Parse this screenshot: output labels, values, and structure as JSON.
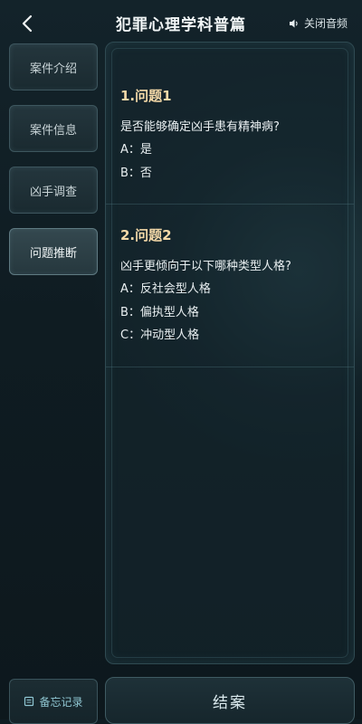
{
  "header": {
    "title": "犯罪心理学科普篇",
    "audio_label": "关闭音频",
    "back_icon": "chevron-left-icon",
    "audio_icon": "speaker-icon"
  },
  "sidebar": {
    "items": [
      {
        "label": "案件介绍",
        "active": false
      },
      {
        "label": "案件信息",
        "active": false
      },
      {
        "label": "凶手调查",
        "active": false
      },
      {
        "label": "问题推断",
        "active": true
      }
    ],
    "memo_label": "备忘记录",
    "memo_icon": "notebook-icon"
  },
  "questions": [
    {
      "title": "1.问题1",
      "text": "是否能够确定凶手患有精神病?",
      "options": [
        "A：是",
        "B：否"
      ]
    },
    {
      "title": "2.问题2",
      "text": "凶手更倾向于以下哪种类型人格?",
      "options": [
        "A：反社会型人格",
        "B：偏执型人格",
        "C：冲动型人格"
      ]
    }
  ],
  "footer": {
    "close_case_label": "结案"
  },
  "colors": {
    "background": "#0f1c22",
    "question_title": "#f4d9a8",
    "memo_accent": "#8fc6d2"
  }
}
